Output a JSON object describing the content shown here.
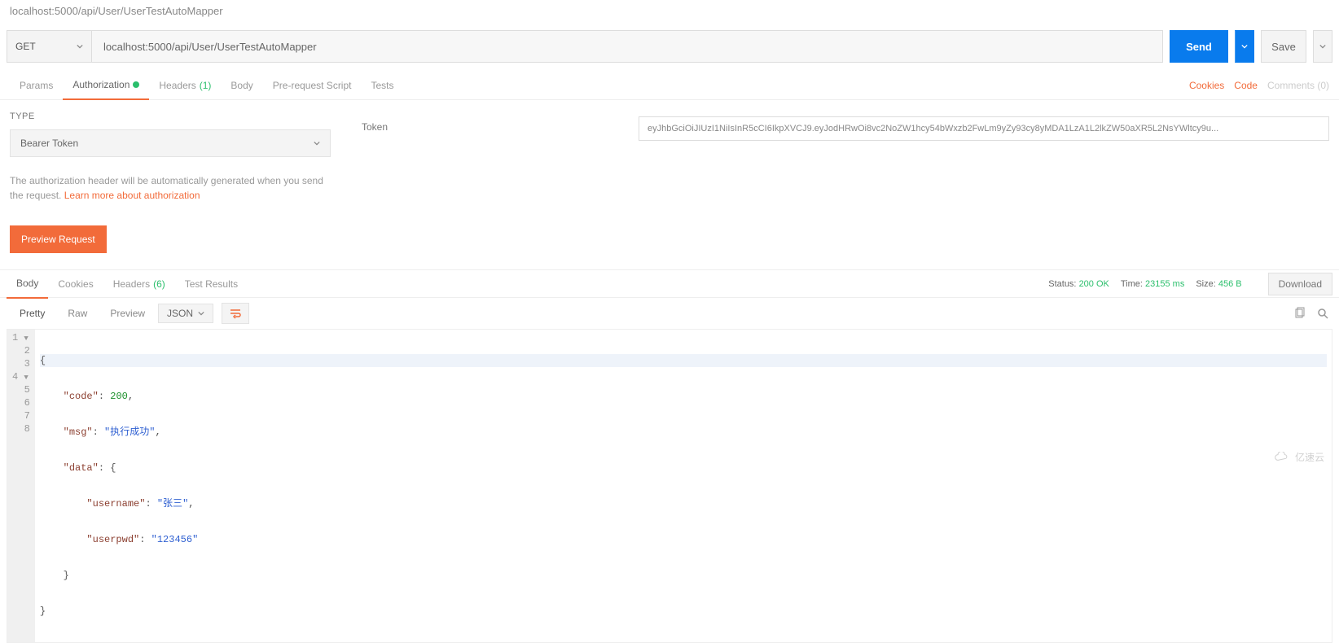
{
  "topbar": {
    "url_display": "localhost:5000/api/User/UserTestAutoMapper"
  },
  "request": {
    "method": "GET",
    "url": "localhost:5000/api/User/UserTestAutoMapper",
    "send_label": "Send",
    "save_label": "Save"
  },
  "tabs": {
    "params": "Params",
    "authorization": "Authorization",
    "headers": "Headers",
    "headers_count": "(1)",
    "body": "Body",
    "prerequest": "Pre-request Script",
    "tests": "Tests"
  },
  "right_links": {
    "cookies": "Cookies",
    "code": "Code",
    "comments": "Comments (0)"
  },
  "auth": {
    "type_label": "TYPE",
    "type_value": "Bearer Token",
    "desc_pre": "The authorization header will be automatically generated when you send the request. ",
    "learn_more": "Learn more about authorization",
    "preview_btn": "Preview Request",
    "token_label": "Token",
    "token_value": "eyJhbGciOiJIUzI1NiIsInR5cCI6IkpXVCJ9.eyJodHRwOi8vc2NoZW1hcy54bWxzb2FwLm9yZy93cy8yMDA1LzA1L2lkZW50aXR5L2NsYWltcy9u..."
  },
  "resp_tabs": {
    "body": "Body",
    "cookies": "Cookies",
    "headers": "Headers",
    "headers_count": "(6)",
    "test_results": "Test Results"
  },
  "status": {
    "status_label": "Status:",
    "status_value": "200 OK",
    "time_label": "Time:",
    "time_value": "23155 ms",
    "size_label": "Size:",
    "size_value": "456 B",
    "download": "Download"
  },
  "resp_toolbar": {
    "pretty": "Pretty",
    "raw": "Raw",
    "preview": "Preview",
    "format": "JSON"
  },
  "response_json": {
    "lines": [
      "1",
      "2",
      "3",
      "4",
      "5",
      "6",
      "7",
      "8"
    ],
    "code": 200,
    "msg": "执行成功",
    "data": {
      "username": "张三",
      "userpwd": "123456"
    }
  },
  "watermark": "亿速云"
}
